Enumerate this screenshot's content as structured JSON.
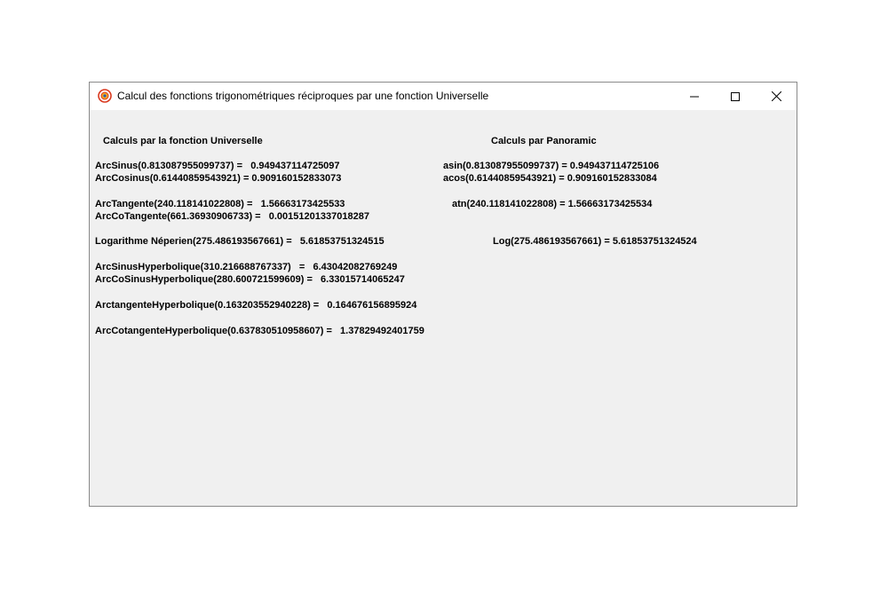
{
  "window": {
    "title": "Calcul des fonctions trigonométriques réciproques par une fonction Universelle",
    "icon": "panoramic-app-icon",
    "controls": [
      "minimize-icon",
      "maximize-icon",
      "close-icon"
    ]
  },
  "headers": {
    "universal": "Calculs par la fonction Universelle",
    "panoramic": "Calculs par Panoramic"
  },
  "universal_results": [
    "ArcSinus(0.813087955099737) =   0.949437114725097",
    "ArcCosinus(0.61440859543921) = 0.909160152833073",
    "ArcTangente(240.118141022808) =   1.56663173425533",
    "ArcCoTangente(661.36930906733) =   0.00151201337018287",
    "Logarithme Néperien(275.486193567661) =   5.61853751324515",
    "ArcSinusHyperbolique(310.216688767337)   =   6.43042082769249",
    "ArcCoSinusHyperbolique(280.600721599609) =   6.33015714065247",
    "ArctangenteHyperbolique(0.163203552940228) =   0.164676156895924",
    "ArcCotangenteHyperbolique(0.637830510958607) =   1.37829492401759"
  ],
  "panoramic_results": [
    "asin(0.813087955099737) = 0.949437114725106",
    "acos(0.61440859543921) = 0.909160152833084",
    "atn(240.118141022808) = 1.56663173425534",
    "Log(275.486193567661) = 5.61853751324524"
  ]
}
